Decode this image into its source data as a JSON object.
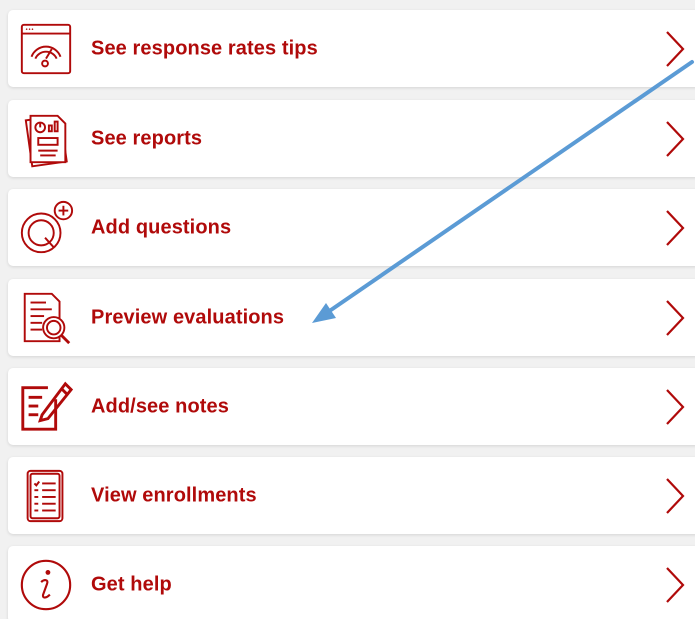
{
  "menu": {
    "items": [
      {
        "label": "See response rates tips",
        "icon": "speedometer-icon"
      },
      {
        "label": "See reports",
        "icon": "report-icon"
      },
      {
        "label": "Add questions",
        "icon": "add-question-icon"
      },
      {
        "label": "Preview evaluations",
        "icon": "preview-document-icon"
      },
      {
        "label": "Add/see notes",
        "icon": "notes-edit-icon"
      },
      {
        "label": "View enrollments",
        "icon": "enrollment-list-icon"
      },
      {
        "label": "Get help",
        "icon": "info-icon"
      }
    ]
  },
  "colors": {
    "accent": "#b00a0a",
    "card_background": "#ffffff",
    "page_background": "#f1f1f1",
    "annotation_arrow": "#5b9bd5"
  }
}
